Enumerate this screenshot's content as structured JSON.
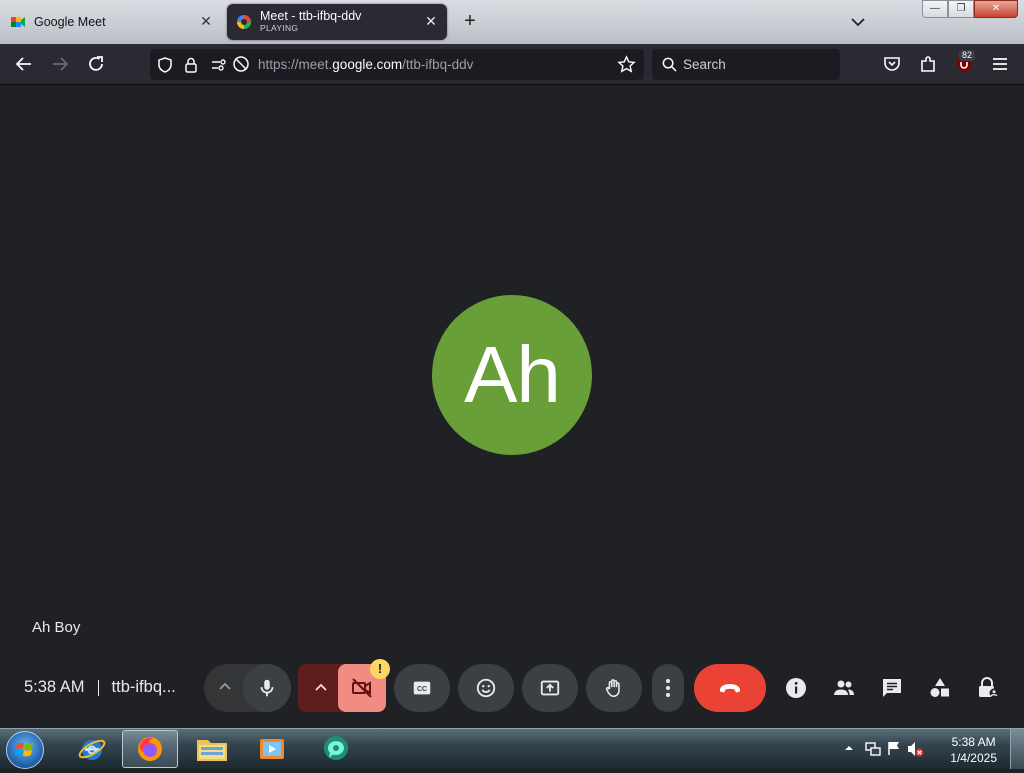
{
  "browser": {
    "tabs": [
      {
        "title": "Google Meet",
        "subtitle": "",
        "active": false
      },
      {
        "title": "Meet - ttb-ifbq-ddv",
        "subtitle": "PLAYING",
        "active": true
      }
    ],
    "new_tab_label": "+",
    "window_controls": {
      "minimize": "—",
      "restore": "❐",
      "close": "✕"
    }
  },
  "toolbar": {
    "url_prefix": "https://meet.",
    "url_domain": "google.com",
    "url_path": "/ttb-ifbq-ddv",
    "search_placeholder": "Search",
    "extension_badge": "82"
  },
  "meet": {
    "avatar_initials": "Ah",
    "avatar_color": "#689f38",
    "participant_name": "Ah Boy",
    "time": "5:38 AM",
    "meeting_code": "ttb-ifbq...",
    "camera_warning": "!"
  },
  "colors": {
    "meet_bg": "#202124",
    "button_bg": "#3c4043",
    "hangup": "#ea4335",
    "camera_off": "#f28b82"
  },
  "taskbar": {
    "apps": [
      "internet-explorer",
      "firefox",
      "file-explorer",
      "media-player",
      "chat-app"
    ],
    "clock_time": "5:38 AM",
    "clock_date": "1/4/2025"
  }
}
